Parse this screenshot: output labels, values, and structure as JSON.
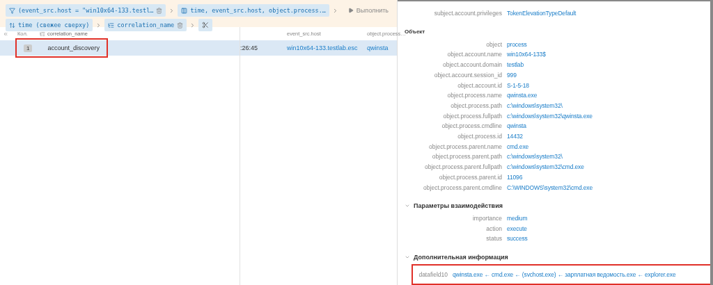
{
  "toolbar": {
    "filters": [
      {
        "kind": "filter",
        "text": "(event_src.host = \"win10x64-133.testl…",
        "removable": true
      },
      {
        "kind": "columns",
        "text": "time, event_src.host, object.process.…",
        "removable": false
      }
    ],
    "sorts": [
      {
        "kind": "sort",
        "text": "time (свежее сверху)",
        "removable": false
      },
      {
        "kind": "group",
        "text": "correlation_name",
        "removable": true
      }
    ],
    "run_button": "Выполнить"
  },
  "table": {
    "columns": [
      "Кол.",
      "correlation_name",
      "event_src.host",
      "object.process…"
    ],
    "rows": [
      {
        "count": "1",
        "correlation_name": "account_discovery",
        "time": ":26:45",
        "event_src_host": "win10x64-133.testlab.esc",
        "object_process": "qwinsta",
        "selected": true,
        "highlighted": true
      }
    ]
  },
  "details": {
    "top_fields": [
      {
        "label": "subject.account.privileges",
        "value": "TokenElevationTypeDefault",
        "highlighted": false
      }
    ],
    "sections": [
      {
        "title": "Объект",
        "collapsible": false,
        "fields": [
          {
            "label": "object",
            "value": "process",
            "highlighted": false
          },
          {
            "label": "object.account.name",
            "value": "win10x64-133$",
            "highlighted": false
          },
          {
            "label": "object.account.domain",
            "value": "testlab",
            "highlighted": false
          },
          {
            "label": "object.account.session_id",
            "value": "999",
            "highlighted": false
          },
          {
            "label": "object.account.id",
            "value": "S-1-5-18",
            "highlighted": false
          },
          {
            "label": "object.process.name",
            "value": "qwinsta.exe",
            "highlighted": false
          },
          {
            "label": "object.process.path",
            "value": "c:\\windows\\system32\\",
            "highlighted": false
          },
          {
            "label": "object.process.fullpath",
            "value": "c:\\windows\\system32\\qwinsta.exe",
            "highlighted": false
          },
          {
            "label": "object.process.cmdline",
            "value": "qwinsta",
            "highlighted": false
          },
          {
            "label": "object.process.id",
            "value": "14432",
            "highlighted": false
          },
          {
            "label": "object.process.parent.name",
            "value": "cmd.exe",
            "highlighted": false
          },
          {
            "label": "object.process.parent.path",
            "value": "c:\\windows\\system32\\",
            "highlighted": false
          },
          {
            "label": "object.process.parent.fullpath",
            "value": "c:\\windows\\system32\\cmd.exe",
            "highlighted": false
          },
          {
            "label": "object.process.parent.id",
            "value": "11096",
            "highlighted": false
          },
          {
            "label": "object.process.parent.cmdline",
            "value": "C:\\WINDOWS\\system32\\cmd.exe",
            "highlighted": false
          }
        ]
      },
      {
        "title": "Параметры взаимодействия",
        "collapsible": true,
        "fields": [
          {
            "label": "importance",
            "value": "medium",
            "highlighted": false
          },
          {
            "label": "action",
            "value": "execute",
            "highlighted": false
          },
          {
            "label": "status",
            "value": "success",
            "highlighted": false
          }
        ]
      },
      {
        "title": "Дополнительная информация",
        "collapsible": true,
        "fields": [
          {
            "label": "datafield10",
            "value": "qwinsta.exe ← cmd.exe ← (svchost.exe) ← зарплатная ведомость.exe ← explorer.exe",
            "highlighted": true
          }
        ]
      }
    ]
  }
}
